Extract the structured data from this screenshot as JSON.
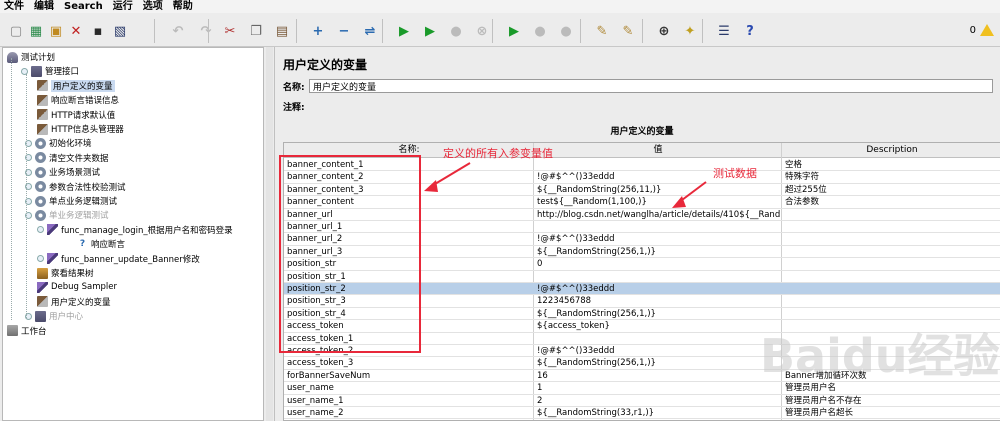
{
  "menu": [
    "文件",
    "编辑",
    "Search",
    "运行",
    "选项",
    "帮助"
  ],
  "toolbar": {
    "icons": [
      "new-icon",
      "template-icon",
      "open-icon",
      "close-icon",
      "save-icon",
      "save-as-icon",
      "undo-icon",
      "redo-icon",
      "cut-icon",
      "copy-icon",
      "paste-icon",
      "expand-icon",
      "collapse-icon",
      "toggle-icon",
      "start-icon",
      "start-no-timers-icon",
      "stop-icon",
      "shutdown-icon",
      "remote-start-icon",
      "remote-stop-icon",
      "remote-shutdown-icon",
      "clear-icon",
      "clear-all-icon",
      "search-icon",
      "reset-search-icon",
      "function-helper-icon",
      "help-icon"
    ],
    "warning_count": "0"
  },
  "tree": [
    {
      "label": "测试计划",
      "icon": "testplan-icon",
      "dim": false,
      "selected": false
    },
    {
      "label": "管理接口",
      "icon": "threadgroup-icon",
      "dim": false,
      "selected": false
    },
    {
      "label": "用户定义的变量",
      "icon": "config-icon",
      "dim": false,
      "selected": true
    },
    {
      "label": "响应断言错误信息",
      "icon": "config-icon",
      "dim": false,
      "selected": false
    },
    {
      "label": "HTTP请求默认值",
      "icon": "config-icon",
      "dim": false,
      "selected": false
    },
    {
      "label": "HTTP信息头管理器",
      "icon": "config-icon",
      "dim": false,
      "selected": false
    },
    {
      "label": "初始化环境",
      "icon": "controller-icon",
      "dim": false,
      "selected": false
    },
    {
      "label": "清空文件夹数据",
      "icon": "controller-icon",
      "dim": false,
      "selected": false
    },
    {
      "label": "业务场景测试",
      "icon": "controller-icon",
      "dim": false,
      "selected": false
    },
    {
      "label": "参数合法性校验测试",
      "icon": "controller-icon",
      "dim": false,
      "selected": false
    },
    {
      "label": "单点业务逻辑测试",
      "icon": "controller-icon",
      "dim": false,
      "selected": false
    },
    {
      "label": "单业务逻辑测试",
      "icon": "controller-icon",
      "dim": true,
      "selected": false
    },
    {
      "label": "func_manage_login_根据用户名和密码登录",
      "icon": "sampler-icon",
      "dim": false,
      "selected": false
    },
    {
      "label": "响应断言",
      "icon": "assertion-icon",
      "dim": false,
      "selected": false
    },
    {
      "label": "func_banner_update_Banner修改",
      "icon": "sampler-icon",
      "dim": false,
      "selected": false
    },
    {
      "label": "察看结果树",
      "icon": "listener-icon",
      "dim": false,
      "selected": false
    },
    {
      "label": "Debug Sampler",
      "icon": "sampler-icon",
      "dim": false,
      "selected": false
    },
    {
      "label": "用户定义的变量",
      "icon": "config-icon",
      "dim": false,
      "selected": false
    },
    {
      "label": "用户中心",
      "icon": "threadgroup-icon",
      "dim": true,
      "selected": false
    },
    {
      "label": "工作台",
      "icon": "workbench-icon",
      "dim": false,
      "selected": false
    }
  ],
  "panel": {
    "title": "用户定义的变量",
    "name_label": "名称:",
    "name_value": "用户定义的变量",
    "comment_label": "注释:",
    "comment_value": "",
    "group_title": "用户定义的变量"
  },
  "table": {
    "columns": [
      "名称:",
      "值",
      "Description"
    ],
    "rows": [
      {
        "name": "banner_content_1",
        "value": "",
        "desc": "空格"
      },
      {
        "name": "banner_content_2",
        "value": "!@#$^^()33eddd",
        "desc": "特殊字符"
      },
      {
        "name": "banner_content_3",
        "value": "${__RandomString(256,11,)}",
        "desc": "超过255位"
      },
      {
        "name": "banner_content",
        "value": "test${__Random(1,100,)}",
        "desc": "合法参数"
      },
      {
        "name": "banner_url",
        "value": "http://blog.csdn.net/wanglha/article/details/410${__Rand...",
        "desc": ""
      },
      {
        "name": "banner_url_1",
        "value": "",
        "desc": ""
      },
      {
        "name": "banner_url_2",
        "value": "!@#$^^()33eddd",
        "desc": ""
      },
      {
        "name": "banner_url_3",
        "value": "${__RandomString(256,1,)}",
        "desc": ""
      },
      {
        "name": "position_str",
        "value": "0",
        "desc": ""
      },
      {
        "name": "position_str_1",
        "value": "",
        "desc": ""
      },
      {
        "name": "position_str_2",
        "value": "!@#$^^()33eddd",
        "desc": ""
      },
      {
        "name": "position_str_3",
        "value": "1223456788",
        "desc": ""
      },
      {
        "name": "position_str_4",
        "value": "${__RandomString(256,1,)}",
        "desc": ""
      },
      {
        "name": "access_token",
        "value": "${access_token}",
        "desc": ""
      },
      {
        "name": "access_token_1",
        "value": "",
        "desc": ""
      },
      {
        "name": "access_token_2",
        "value": "!@#$^^()33eddd",
        "desc": ""
      },
      {
        "name": "access_token_3",
        "value": "${__RandomString(256,1,)}",
        "desc": ""
      },
      {
        "name": "forBannerSaveNum",
        "value": "16",
        "desc": "Banner增加循环次数"
      },
      {
        "name": "user_name",
        "value": "1",
        "desc": "管理员用户名"
      },
      {
        "name": "user_name_1",
        "value": "2",
        "desc": "管理员用户名不存在"
      },
      {
        "name": "user_name_2",
        "value": "${__RandomString(33,r1,)}",
        "desc": "管理员用户名超长"
      }
    ],
    "selected_row": 10
  },
  "annotations": {
    "left_note": "定义的所有入参变量值",
    "right_note": "测试数据",
    "color": "#e8283a"
  },
  "watermark": "Baidu经验"
}
